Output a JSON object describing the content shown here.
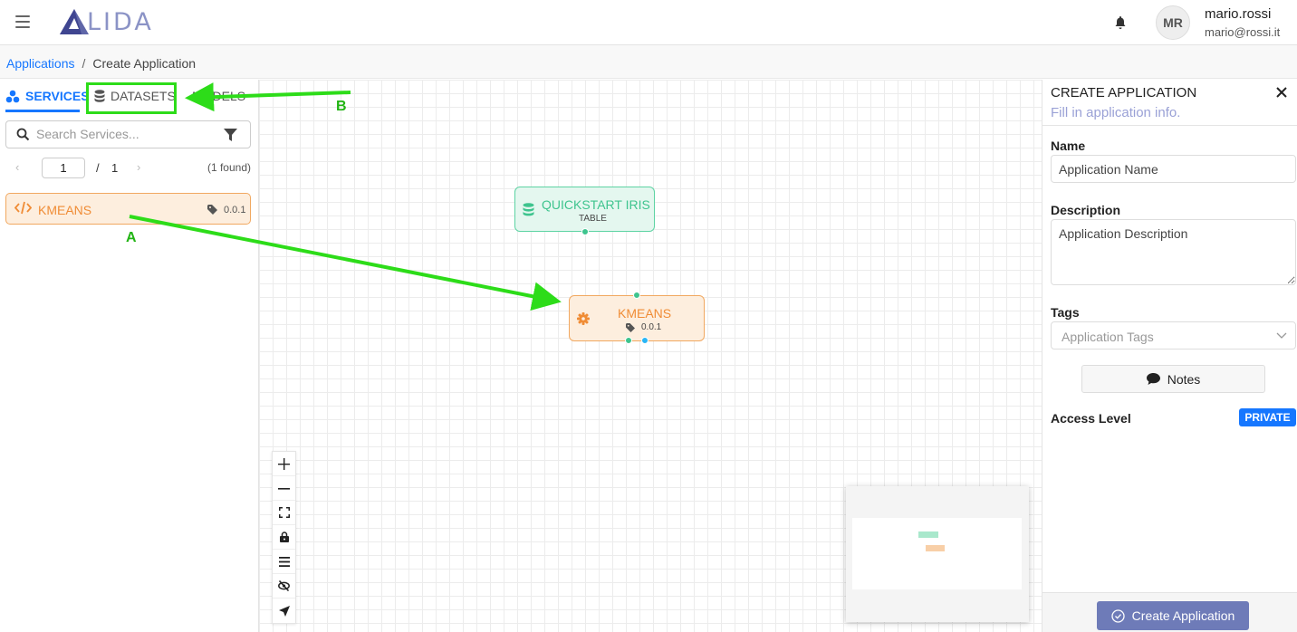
{
  "header": {
    "logo_text": "LIDA",
    "user_initials": "MR",
    "user_name": "mario.rossi",
    "user_email": "mario@rossi.it"
  },
  "breadcrumb": {
    "root": "Applications",
    "separator": "/",
    "current": "Create Application"
  },
  "left_panel": {
    "tabs": {
      "services": "SERVICES",
      "datasets": "DATASETS",
      "models": "MODELS"
    },
    "search_placeholder": "Search Services...",
    "pager": {
      "page": "1",
      "slash": "/",
      "total": "1",
      "found": "(1 found)"
    },
    "items": [
      {
        "name": "KMEANS",
        "version": "0.0.1"
      }
    ]
  },
  "canvas": {
    "nodes": [
      {
        "title": "QUICKSTART IRIS",
        "subtitle": "TABLE",
        "kind": "dataset"
      },
      {
        "title": "KMEANS",
        "version": "0.0.1",
        "kind": "service"
      }
    ]
  },
  "right_panel": {
    "title": "CREATE APPLICATION",
    "subtitle": "Fill in application info.",
    "name_label": "Name",
    "name_placeholder": "Application Name",
    "description_label": "Description",
    "description_placeholder": "Application Description",
    "tags_label": "Tags",
    "tags_placeholder": "Application Tags",
    "notes_label": "Notes",
    "access_label": "Access Level",
    "access_value": "PRIVATE",
    "create_label": "Create Application"
  },
  "annotations": {
    "label_a": "A",
    "label_b": "B"
  },
  "colors": {
    "primary": "#1677ff",
    "service_orange": "#f08c35",
    "dataset_green": "#3ec48e",
    "annotation_green": "#2ddc19",
    "create_button": "#6e7bb8"
  }
}
